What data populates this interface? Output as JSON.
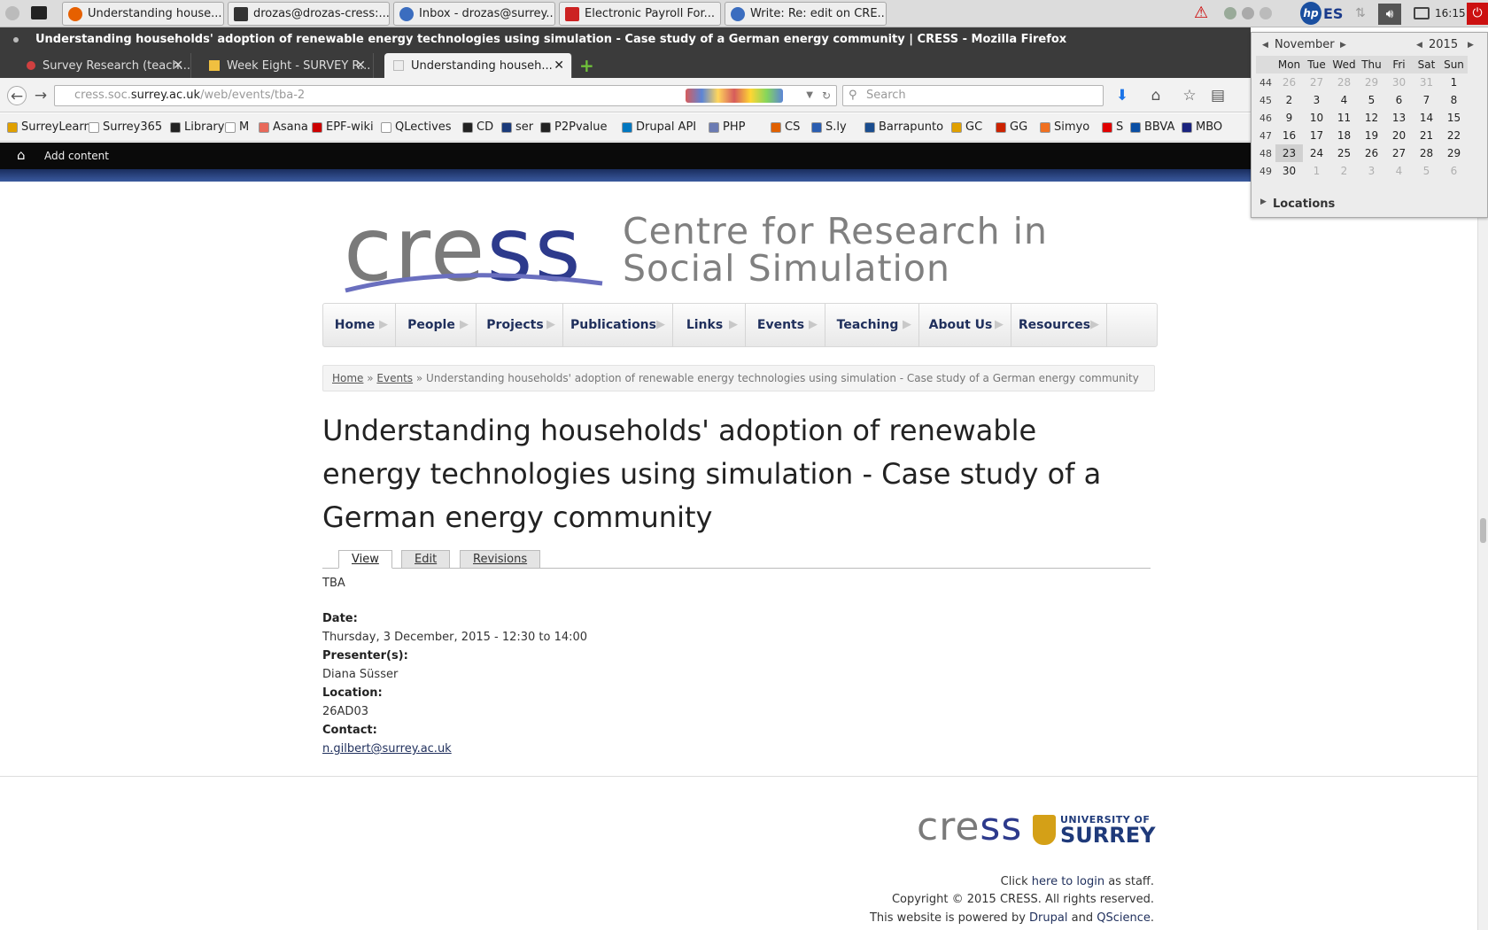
{
  "panel": {
    "tasks": [
      {
        "label": "Understanding house...",
        "color": "#e66000"
      },
      {
        "label": "drozas@drozas-cress:...",
        "color": "#333333"
      },
      {
        "label": "Inbox - drozas@surrey...",
        "color": "#3b6dbf"
      },
      {
        "label": "Electronic Payroll For...",
        "color": "#cc2222"
      },
      {
        "label": "Write: Re: edit on CRE...",
        "color": "#3b6dbf"
      }
    ],
    "keyboard_layout": "ES",
    "clock": "16:15"
  },
  "window": {
    "title": "Understanding households' adoption of renewable energy technologies using simulation - Case study of a German energy community | CRESS - Mozilla Firefox"
  },
  "tabs": [
    {
      "label": "Survey Research (teach...",
      "active": false
    },
    {
      "label": "Week Eight - SURVEY R...",
      "active": false
    },
    {
      "label": "Understanding househ...",
      "active": true
    }
  ],
  "navbar": {
    "url_gray_prefix": "cress.soc.",
    "url_domain": "surrey.ac.uk",
    "url_path": "/web/events/tba-2",
    "search_placeholder": "Search"
  },
  "bookmarks": [
    {
      "label": "SurreyLearn",
      "color": "#e0a000"
    },
    {
      "label": "Surrey365",
      "color": "#ffffff"
    },
    {
      "label": "Library",
      "color": "#222222"
    },
    {
      "label": "M",
      "color": "#ffffff"
    },
    {
      "label": "Asana",
      "color": "#e8695a"
    },
    {
      "label": "EPF-wiki",
      "color": "#cc0000"
    },
    {
      "label": "QLectives",
      "color": "#ffffff"
    },
    {
      "label": "CD",
      "color": "#222222"
    },
    {
      "label": "ser",
      "color": "#1a3a7a"
    },
    {
      "label": "P2Pvalue",
      "color": "#222222"
    },
    {
      "label": "Drupal API",
      "color": "#0077c0"
    },
    {
      "label": "PHP",
      "color": "#6b7bb3"
    },
    {
      "label": "CS",
      "color": "#e06000"
    },
    {
      "label": "S.ly",
      "color": "#2a5db0"
    },
    {
      "label": "Barrapunto",
      "color": "#1a4d8f"
    },
    {
      "label": "GC",
      "color": "#e0a000"
    },
    {
      "label": "GG",
      "color": "#cc2200"
    },
    {
      "label": "Simyo",
      "color": "#f07020"
    },
    {
      "label": "S",
      "color": "#e00000"
    },
    {
      "label": "BBVA",
      "color": "#0a4ea3"
    },
    {
      "label": "MBO",
      "color": "#1a237e"
    }
  ],
  "toolbar": {
    "add_content": "Add content"
  },
  "logo": {
    "cre": "cre",
    "ss": "ss",
    "subtitle_line1": "Centre for Research in",
    "subtitle_line2": "Social Simulation"
  },
  "mainnav": [
    "Home",
    "People",
    "Projects",
    "Publications",
    "Links",
    "Events",
    "Teaching",
    "About Us",
    "Resources"
  ],
  "breadcrumb": {
    "home": "Home",
    "events": "Events",
    "current": "Understanding households' adoption of renewable energy technologies using simulation - Case study of a German energy community"
  },
  "page": {
    "title": "Understanding households' adoption of renewable energy technologies using simulation - Case study of a German energy community",
    "tabs": [
      "View",
      "Edit",
      "Revisions"
    ],
    "body": "TBA",
    "date_label": "Date:",
    "date_value": "Thursday, 3 December, 2015 - 12:30 to 14:00",
    "presenter_label": "Presenter(s):",
    "presenter_value": "Diana Süsser",
    "location_label": "Location:",
    "location_value": "26AD03",
    "contact_label": "Contact:",
    "contact_value": "n.gilbert@surrey.ac.uk"
  },
  "footer": {
    "logo_cre": "cre",
    "logo_ss": "ss",
    "uni_small": "UNIVERSITY OF",
    "uni_big": "SURREY",
    "login_pre": "Click",
    "login_link": "here to login",
    "login_post": "as staff.",
    "copyright": "Copyright © 2015 CRESS. All rights reserved.",
    "powered_pre": "This website is powered by",
    "powered_drupal": "Drupal",
    "powered_and": "and",
    "powered_qscience": "QScience",
    "powered_end": "."
  },
  "calendar": {
    "month": "November",
    "year": "2015",
    "weekdays": [
      "Mon",
      "Tue",
      "Wed",
      "Thu",
      "Fri",
      "Sat",
      "Sun"
    ],
    "weeks": [
      {
        "wk": "44",
        "days": [
          "26",
          "27",
          "28",
          "29",
          "30",
          "31",
          "1"
        ],
        "dim": [
          1,
          1,
          1,
          1,
          1,
          1,
          0
        ]
      },
      {
        "wk": "45",
        "days": [
          "2",
          "3",
          "4",
          "5",
          "6",
          "7",
          "8"
        ],
        "dim": [
          0,
          0,
          0,
          0,
          0,
          0,
          0
        ]
      },
      {
        "wk": "46",
        "days": [
          "9",
          "10",
          "11",
          "12",
          "13",
          "14",
          "15"
        ],
        "dim": [
          0,
          0,
          0,
          0,
          0,
          0,
          0
        ]
      },
      {
        "wk": "47",
        "days": [
          "16",
          "17",
          "18",
          "19",
          "20",
          "21",
          "22"
        ],
        "dim": [
          0,
          0,
          0,
          0,
          0,
          0,
          0
        ]
      },
      {
        "wk": "48",
        "days": [
          "23",
          "24",
          "25",
          "26",
          "27",
          "28",
          "29"
        ],
        "dim": [
          0,
          0,
          0,
          0,
          0,
          0,
          0
        ]
      },
      {
        "wk": "49",
        "days": [
          "30",
          "1",
          "2",
          "3",
          "4",
          "5",
          "6"
        ],
        "dim": [
          0,
          1,
          1,
          1,
          1,
          1,
          1
        ]
      }
    ],
    "today": "23",
    "locations_label": "Locations"
  }
}
